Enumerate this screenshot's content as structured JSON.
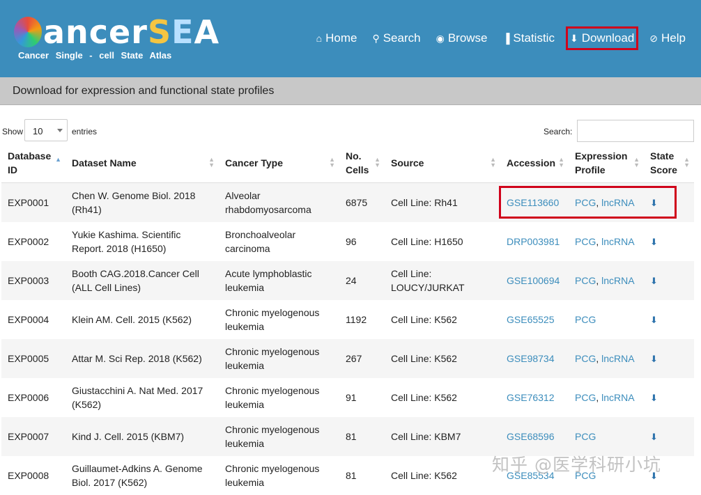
{
  "logo": {
    "title_c": "C",
    "title_ancer": "ancer",
    "title_s": "S",
    "title_e": "E",
    "title_a": "A",
    "subtitle": "Cancer Single - cell State Atlas"
  },
  "nav": [
    {
      "icon": "⌂",
      "label": "Home"
    },
    {
      "icon": "⚲",
      "label": "Search"
    },
    {
      "icon": "◉",
      "label": "Browse"
    },
    {
      "icon": "▐",
      "label": "Statistic"
    },
    {
      "icon": "⬇",
      "label": "Download"
    },
    {
      "icon": "⊘",
      "label": "Help"
    }
  ],
  "panel": {
    "title": "Download for expression and functional state profiles"
  },
  "controls": {
    "show": "Show",
    "page_size": "10",
    "entries": "entries",
    "search_label": "Search:",
    "search_value": ""
  },
  "table": {
    "headers": [
      "Database ID",
      "Dataset Name",
      "Cancer Type",
      "No. Cells",
      "Source",
      "Accession",
      "Expression Profile",
      "State Score"
    ],
    "rows": [
      {
        "id": "EXP0001",
        "name": "Chen W. Genome Biol. 2018 (Rh41)",
        "cancer": "Alveolar rhabdomyosarcoma",
        "cells": "6875",
        "source": "Cell Line: Rh41",
        "accession": "GSE113660",
        "pcg": "PCG",
        "lnc": "lncRNA"
      },
      {
        "id": "EXP0002",
        "name": "Yukie Kashima. Scientific Report. 2018 (H1650)",
        "cancer": "Bronchoalveolar carcinoma",
        "cells": "96",
        "source": "Cell Line: H1650",
        "accession": "DRP003981",
        "pcg": "PCG",
        "lnc": "lncRNA"
      },
      {
        "id": "EXP0003",
        "name": "Booth CAG.2018.Cancer Cell (ALL Cell Lines)",
        "cancer": "Acute lymphoblastic leukemia",
        "cells": "24",
        "source": "Cell Line: LOUCY/JURKAT",
        "accession": "GSE100694",
        "pcg": "PCG",
        "lnc": "lncRNA"
      },
      {
        "id": "EXP0004",
        "name": "Klein AM. Cell. 2015 (K562)",
        "cancer": "Chronic myelogenous leukemia",
        "cells": "1192",
        "source": "Cell Line: K562",
        "accession": "GSE65525",
        "pcg": "PCG",
        "lnc": ""
      },
      {
        "id": "EXP0005",
        "name": "Attar M. Sci Rep. 2018 (K562)",
        "cancer": "Chronic myelogenous leukemia",
        "cells": "267",
        "source": "Cell Line: K562",
        "accession": "GSE98734",
        "pcg": "PCG",
        "lnc": "lncRNA"
      },
      {
        "id": "EXP0006",
        "name": "Giustacchini A. Nat Med. 2017 (K562)",
        "cancer": "Chronic myelogenous leukemia",
        "cells": "91",
        "source": "Cell Line: K562",
        "accession": "GSE76312",
        "pcg": "PCG",
        "lnc": "lncRNA"
      },
      {
        "id": "EXP0007",
        "name": "Kind J. Cell. 2015 (KBM7)",
        "cancer": "Chronic myelogenous leukemia",
        "cells": "81",
        "source": "Cell Line: KBM7",
        "accession": "GSE68596",
        "pcg": "PCG",
        "lnc": ""
      },
      {
        "id": "EXP0008",
        "name": "Guillaumet-Adkins A. Genome Biol. 2017 (K562)",
        "cancer": "Chronic myelogenous leukemia",
        "cells": "81",
        "source": "Cell Line: K562",
        "accession": "GSE85534",
        "pcg": "PCG",
        "lnc": ""
      }
    ]
  },
  "watermark": "知乎 @医学科研小坑",
  "colors": {
    "navbar": "#3c8dbc",
    "link": "#3c8dbc",
    "highlight": "#d0021b"
  }
}
